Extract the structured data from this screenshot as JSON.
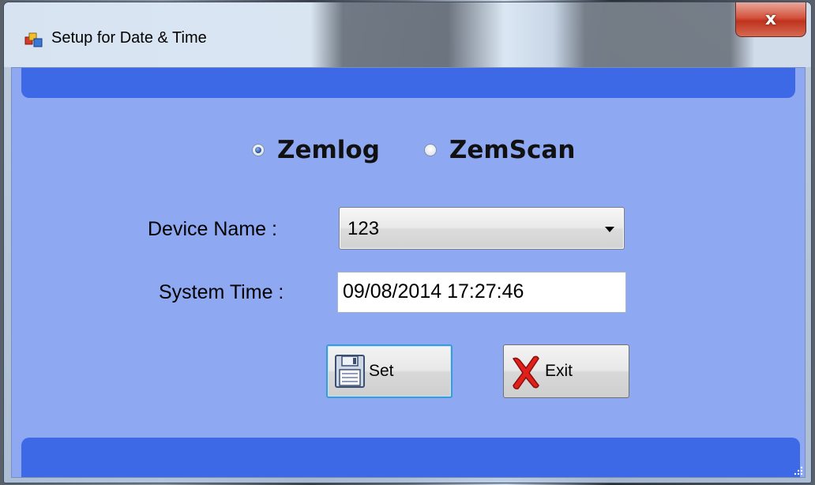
{
  "window": {
    "title": "Setup for Date & Time",
    "close_label": "x"
  },
  "device_type": {
    "options": [
      {
        "label": "Zemlog",
        "selected": true
      },
      {
        "label": "ZemScan",
        "selected": false
      }
    ]
  },
  "form": {
    "device_name_label": "Device Name :",
    "device_name_value": "123",
    "system_time_label": "System Time :",
    "system_time_value": "09/08/2014 17:27:46"
  },
  "buttons": {
    "set_label": "Set",
    "exit_label": "Exit"
  },
  "colors": {
    "client_bg": "#8ea8f2",
    "band": "#3d69e6"
  },
  "icons": {
    "app": "app-icon",
    "set": "floppy-disk-icon",
    "exit": "red-x-icon",
    "close": "close-icon"
  }
}
